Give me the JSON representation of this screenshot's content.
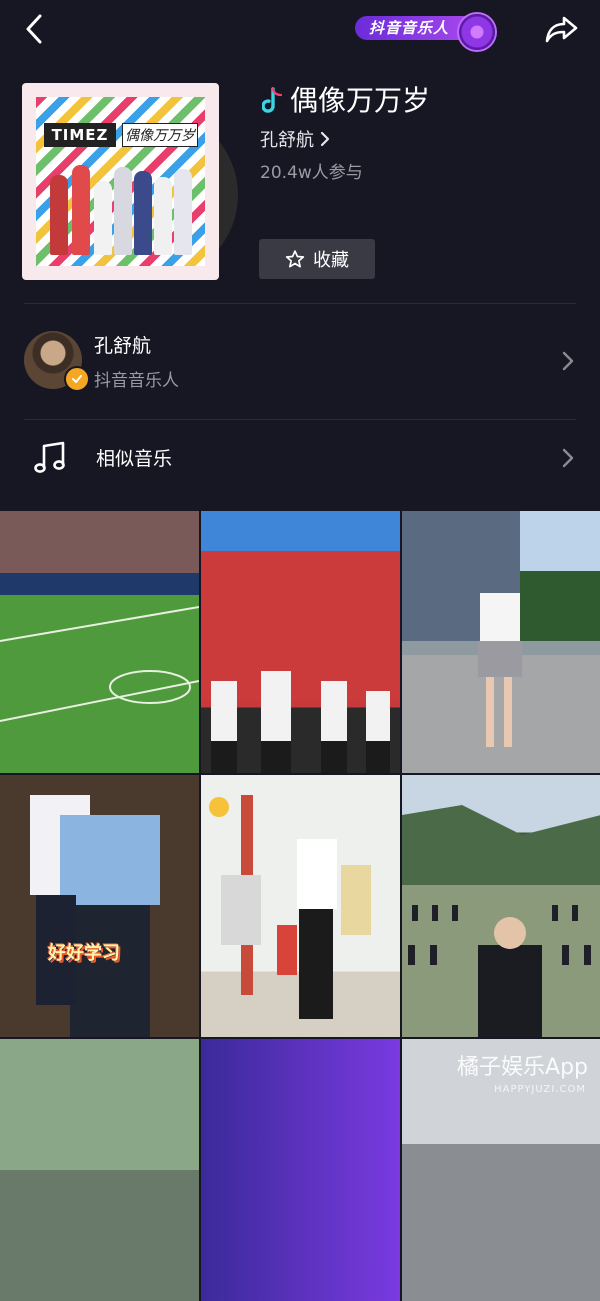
{
  "header": {
    "badge_label": "抖音音乐人"
  },
  "song": {
    "title": "偶像万万岁",
    "artist": "孔舒航",
    "participants": "20.4w人参与",
    "favorite_label": "收藏",
    "cover_logo": "TIMEZ",
    "cover_title": "偶像万万岁"
  },
  "artist_row": {
    "name": "孔舒航",
    "role": "抖音音乐人"
  },
  "similar_row": {
    "label": "相似音乐"
  },
  "videos": [
    {
      "scene": "football-stadium"
    },
    {
      "scene": "kids-dancing-red-pavilion"
    },
    {
      "scene": "girl-dancing-plaza"
    },
    {
      "scene": "school-uniform",
      "caption": "好好学习"
    },
    {
      "scene": "dancing-hallway"
    },
    {
      "scene": "field-mass-dance"
    },
    {
      "scene": "playground"
    },
    {
      "scene": "purple-stage"
    },
    {
      "scene": "building"
    }
  ],
  "watermark": {
    "main": "橘子娱乐App",
    "sub": "HAPPYJUZI.COM"
  },
  "colors": {
    "background": "#161723",
    "accent_purple": "#9b3cf0",
    "verified_badge": "#f5a623",
    "note_icon_cyan": "#3ad6e6"
  }
}
